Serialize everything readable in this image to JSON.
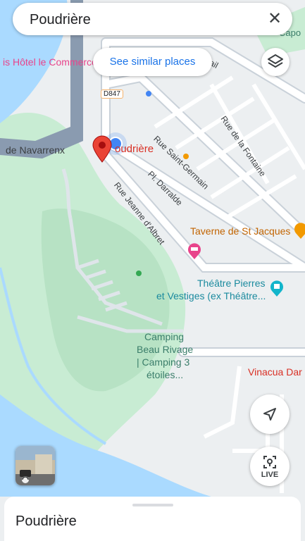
{
  "search": {
    "query": "Poudrière",
    "close_label": "✕"
  },
  "chips": {
    "similar_places": "See similar places"
  },
  "map": {
    "labels": {
      "hotel": "is Hôtel le Commerce",
      "road_number": "D847",
      "navarrenx": "de Navarrenx",
      "poudriere": "oudrière",
      "rue_saint_germain": "Rue Saint-Germain",
      "rue_de_la_fontaine": "Rue de la Fontaine",
      "pl_darralde": "Pl. Darralde",
      "rue_jeanne": "Rue Jeanne d'Albret",
      "taverne": "Taverne de St Jacques",
      "theatre_1": "Théâtre Pierres",
      "theatre_2": "et Vestiges (ex Théâtre...",
      "camping_1": "Camping",
      "camping_2": "Beau Rivage",
      "camping_3": "| Camping 3",
      "camping_4": "étoiles...",
      "vinacua": "Vinacua Dar",
      "rail": "rail",
      "capo": "Capo"
    },
    "colors": {
      "water": "#aadaff",
      "park": "#c8ecd3",
      "park_dark": "#b7e2c4",
      "road": "#ffffff",
      "road_outline": "#c9d1d9",
      "place_text": "#3a7d6a",
      "red_text": "#d93025",
      "orange_text": "#c26401"
    }
  },
  "controls": {
    "navigate_icon": "navigation-arrow-icon",
    "live_label": "LIVE",
    "layers_icon": "layers-icon"
  },
  "sheet": {
    "title": "Poudrière"
  }
}
